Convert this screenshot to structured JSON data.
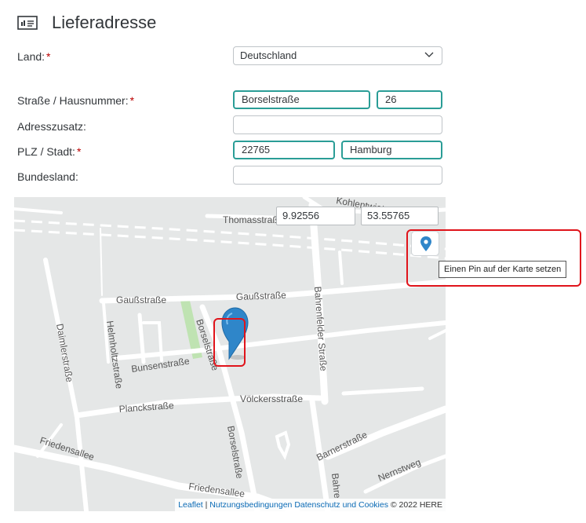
{
  "header": {
    "title": "Lieferadresse",
    "icon": "form-icon"
  },
  "form": {
    "country_label": "Land:",
    "country_value": "Deutschland",
    "street_label": "Straße / Hausnummer:",
    "street_value": "Borselstraße",
    "house_number_value": "26",
    "address_extra_label": "Adresszusatz:",
    "address_extra_value": "",
    "zip_city_label": "PLZ / Stadt:",
    "zip_value": "22765",
    "city_value": "Hamburg",
    "state_label": "Bundesland:",
    "state_value": "",
    "required_mark": "*"
  },
  "map": {
    "longitude": "9.92556",
    "latitude": "53.55765",
    "pin_button_tooltip": "Einen Pin auf der Karte setzen",
    "attribution": {
      "leaflet": "Leaflet",
      "separator": "|",
      "terms": "Nutzungsbedingungen",
      "privacy": "Datenschutz und Cookies",
      "copyright": "© 2022 HERE"
    },
    "street_labels": {
      "thomasstrasse": "Thomasstraße",
      "kohlentwiete": "Kohlentwiete",
      "gaussstrasse_1": "Gaußstraße",
      "gaussstrasse_2": "Gaußstraße",
      "helmholtzstrasse": "Helmholtzstraße",
      "daimlerstrasse": "Daimlerstraße",
      "bunsenstrasse": "Bunsenstraße",
      "borselstrasse_1": "Borselstraße",
      "borselstrasse_2": "Borselstraße",
      "bahrenfelder_strasse": "Bahrenfelder Straße",
      "planckstrasse": "Planckstraße",
      "voelckersstrasse": "Völckersstraße",
      "friedensallee_1": "Friedensallee",
      "friedensallee_2": "Friedensallee",
      "barnerstrasse": "Barnerstraße",
      "nernstweg": "Nernstweg",
      "bahre": "Bahre"
    },
    "colors": {
      "pin": "#2f86c9",
      "highlight": "#e0141b",
      "valid_border": "#2a9d96"
    }
  }
}
